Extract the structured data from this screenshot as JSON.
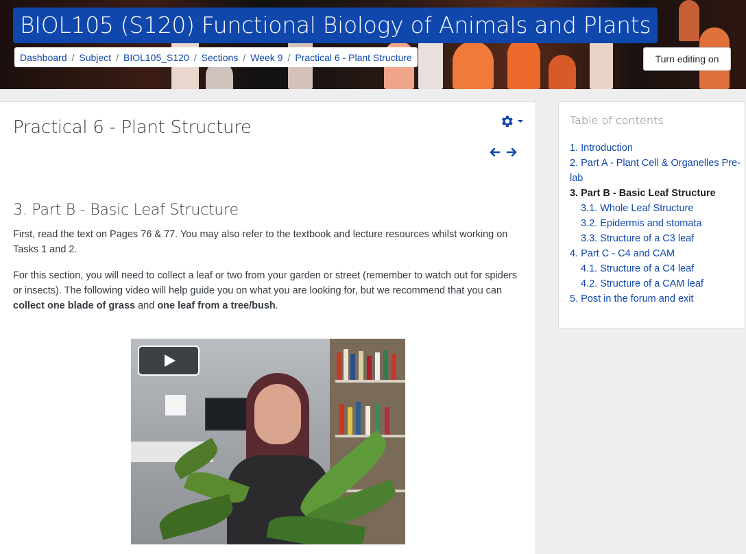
{
  "header": {
    "course_title": "BIOL105 (S120) Functional Biology of Animals and Plants",
    "breadcrumb": [
      "Dashboard",
      "Subject",
      "BIOL105_S120",
      "Sections",
      "Week 9",
      "Practical 6 - Plant Structure"
    ],
    "breadcrumb_separator": "/",
    "edit_button": "Turn editing on"
  },
  "main": {
    "page_title": "Practical 6 - Plant Structure",
    "section_heading": "3. Part B - Basic Leaf Structure",
    "para1": "First, read the text on Pages 76 & 77. You may also refer to the textbook and lecture resources whilst working on Tasks 1 and 2.",
    "para2_start": "For this section, you will need to collect a leaf or two from your garden or street (remember to watch out for spiders or insects). The following video will help guide you on what you are looking for, but we recommend that you can ",
    "para2_bold1": "collect one blade of grass",
    "para2_mid": " and ",
    "para2_bold2": "one leaf from a tree/bush",
    "para2_end": ".",
    "icons": {
      "settings": "gear-icon",
      "prev": "arrow-left-icon",
      "next": "arrow-right-icon",
      "play": "play-icon"
    }
  },
  "toc": {
    "title": "Table of contents",
    "items": [
      {
        "label": "1. Introduction",
        "level": 1,
        "current": false
      },
      {
        "label": "2. Part A - Plant Cell & Organelles Pre-lab",
        "level": 1,
        "current": false
      },
      {
        "label": "3. Part B - Basic Leaf Structure",
        "level": 1,
        "current": true
      },
      {
        "label": "3.1. Whole Leaf Structure",
        "level": 2,
        "current": false
      },
      {
        "label": "3.2. Epidermis and stomata",
        "level": 2,
        "current": false
      },
      {
        "label": "3.3. Structure of a C3 leaf",
        "level": 2,
        "current": false
      },
      {
        "label": "4. Part C - C4 and CAM",
        "level": 1,
        "current": false
      },
      {
        "label": "4.1. Structure of a C4 leaf",
        "level": 2,
        "current": false
      },
      {
        "label": "4.2. Structure of a CAM leaf",
        "level": 2,
        "current": false
      },
      {
        "label": "5. Post in the forum and exit",
        "level": 1,
        "current": false
      }
    ]
  },
  "colors": {
    "brand": "#0f47ad",
    "text": "#343a40",
    "muted": "#6a737b",
    "page_bg": "#eeeeee"
  }
}
